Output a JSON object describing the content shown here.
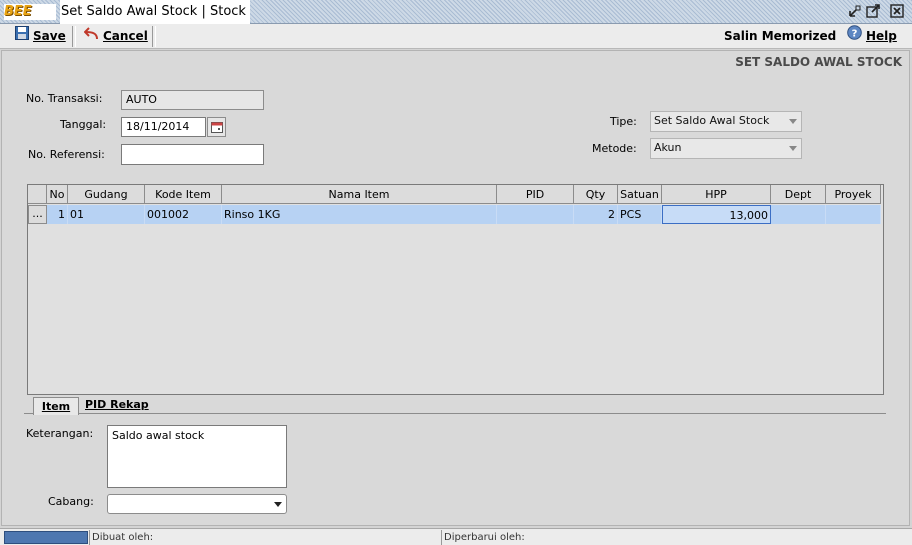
{
  "window": {
    "logo_text": "BEE",
    "title": "Set Saldo Awal Stock | Stock",
    "controls": [
      "minimize-icon",
      "restore-icon",
      "close-icon"
    ]
  },
  "toolbar": {
    "save_label": "Save",
    "cancel_label": "Cancel",
    "salin_label": "Salin Memorized",
    "help_label": "Help"
  },
  "header": {
    "section_title": "SET SALDO AWAL STOCK"
  },
  "form": {
    "no_transaksi_label": "No. Transaksi:",
    "no_transaksi_value": "AUTO",
    "tanggal_label": "Tanggal:",
    "tanggal_value": "18/11/2014",
    "no_referensi_label": "No. Referensi:",
    "no_referensi_value": "",
    "tipe_label": "Tipe:",
    "tipe_value": "Set Saldo Awal Stock",
    "metode_label": "Metode:",
    "metode_value": "Akun"
  },
  "grid": {
    "columns": [
      "No",
      "Gudang",
      "Kode Item",
      "Nama Item",
      "PID",
      "Qty",
      "Satuan",
      "HPP",
      "Dept",
      "Proyek"
    ],
    "rows": [
      {
        "btn": "...",
        "no": "1",
        "gudang": "01",
        "kode": "001002",
        "nama": "Rinso 1KG",
        "pid": "",
        "qty": "2",
        "satuan": "PCS",
        "hpp": "13,000",
        "dept": "",
        "proyek": ""
      }
    ]
  },
  "tabs": [
    "Item",
    "PID Rekap"
  ],
  "footer": {
    "keterangan_label": "Keterangan:",
    "keterangan_value": "Saldo awal stock",
    "cabang_label": "Cabang:",
    "cabang_value": ""
  },
  "status": {
    "dibuat_label": "Dibuat oleh:",
    "diperbarui_label": "Diperbarui oleh:"
  }
}
